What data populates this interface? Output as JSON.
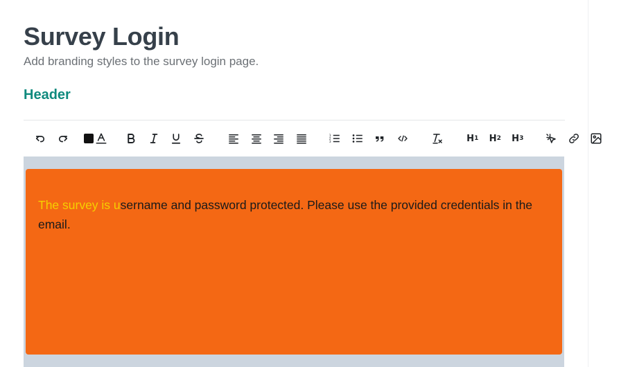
{
  "page": {
    "title": "Survey Login",
    "subtitle": "Add branding styles to the survey login page.",
    "section_title": "Header"
  },
  "toolbar": {
    "groups": [
      [
        "undo-icon",
        "redo-icon"
      ],
      [
        "text-color-swatch",
        "highlight-color-icon"
      ],
      [
        "bold-icon",
        "italic-icon",
        "underline-icon",
        "strikethrough-icon"
      ],
      [
        "align-left-icon",
        "align-center-icon",
        "align-right-icon",
        "align-justify-icon"
      ],
      [
        "ordered-list-icon",
        "bullet-list-icon",
        "blockquote-icon",
        "code-icon"
      ],
      [
        "clear-formatting-icon"
      ],
      [
        "heading-1",
        "heading-2",
        "heading-3"
      ],
      [
        "cursor-click-icon",
        "link-icon",
        "image-icon"
      ]
    ],
    "h1": "H",
    "h1_sub": "1",
    "h2": "H",
    "h2_sub": "2",
    "h3": "H",
    "h3_sub": "3",
    "text_color": "#111111"
  },
  "editor": {
    "highlighted_text": "The survey is u",
    "rest_text": "sername and password protected. Please use the provided credentials in the email.",
    "highlight_color": "#f5d000",
    "background_color": "#f46814",
    "frame_color": "#ccd5df"
  }
}
